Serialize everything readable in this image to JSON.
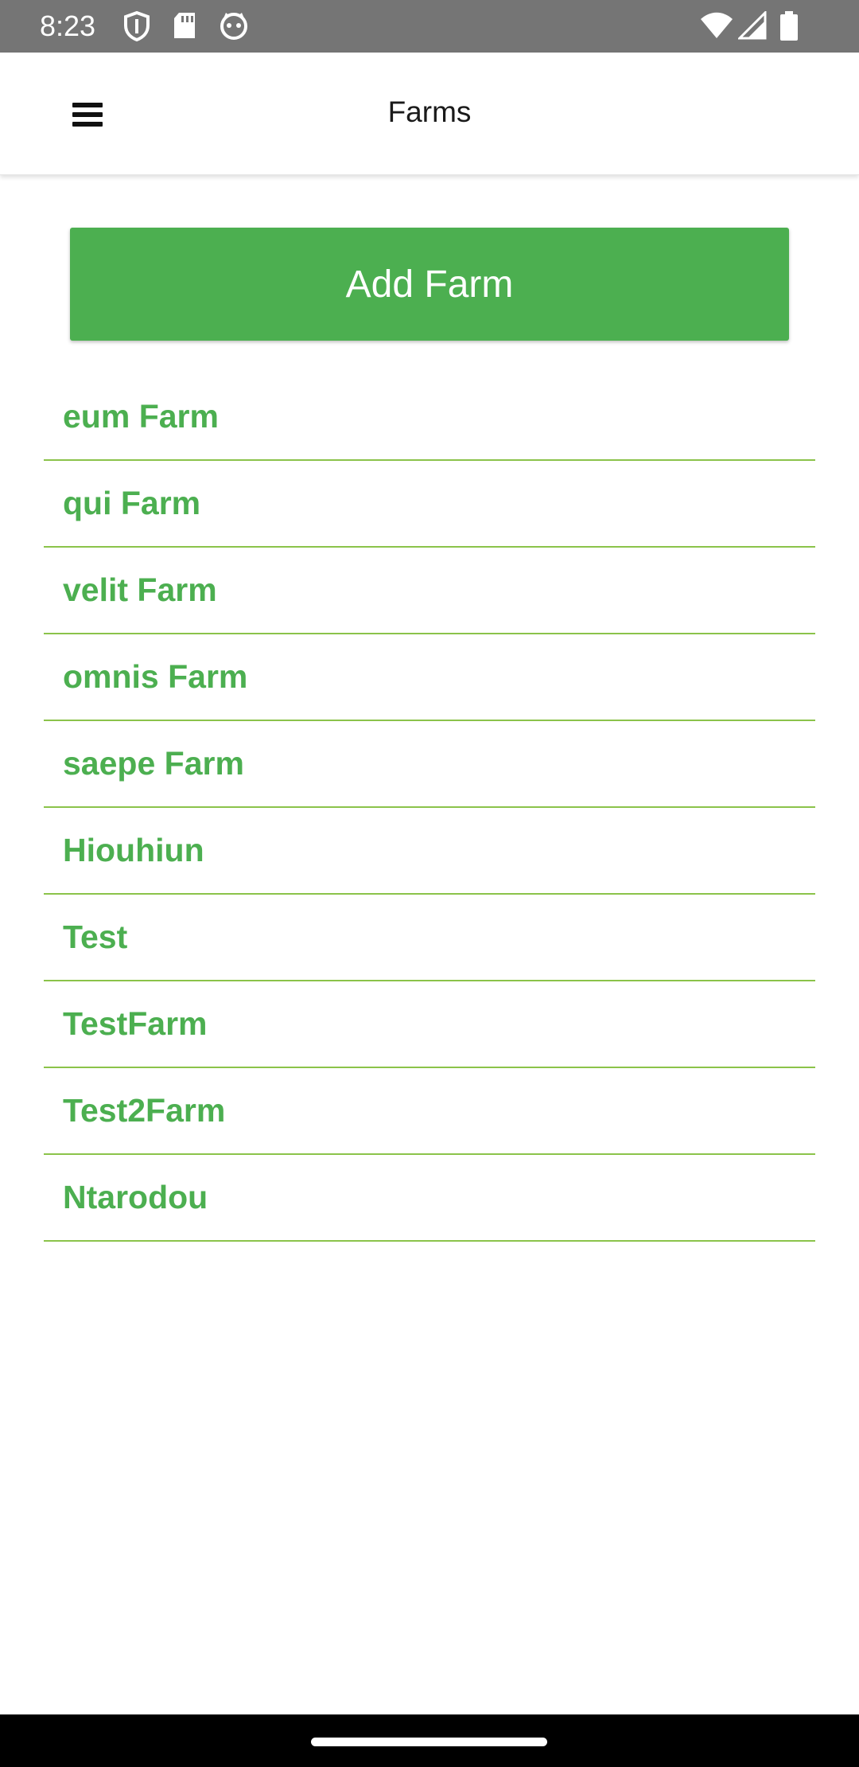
{
  "status_bar": {
    "time": "8:23",
    "left_icons": [
      "shield-icon",
      "sd-card-icon",
      "cat-face-icon"
    ],
    "right_icons": [
      "wifi-icon",
      "signal-icon",
      "battery-icon"
    ]
  },
  "app_bar": {
    "title": "Farms",
    "menu_icon": "hamburger-menu-icon"
  },
  "main": {
    "add_button_label": "Add Farm",
    "farms": [
      "eum Farm",
      "qui Farm",
      "velit Farm",
      "omnis Farm",
      "saepe Farm",
      "Hiouhiun",
      "Test",
      "TestFarm",
      "Test2Farm",
      "Ntarodou"
    ]
  },
  "colors": {
    "accent": "#4caf50",
    "divider": "#8bc34a",
    "status_bar": "#757575"
  }
}
